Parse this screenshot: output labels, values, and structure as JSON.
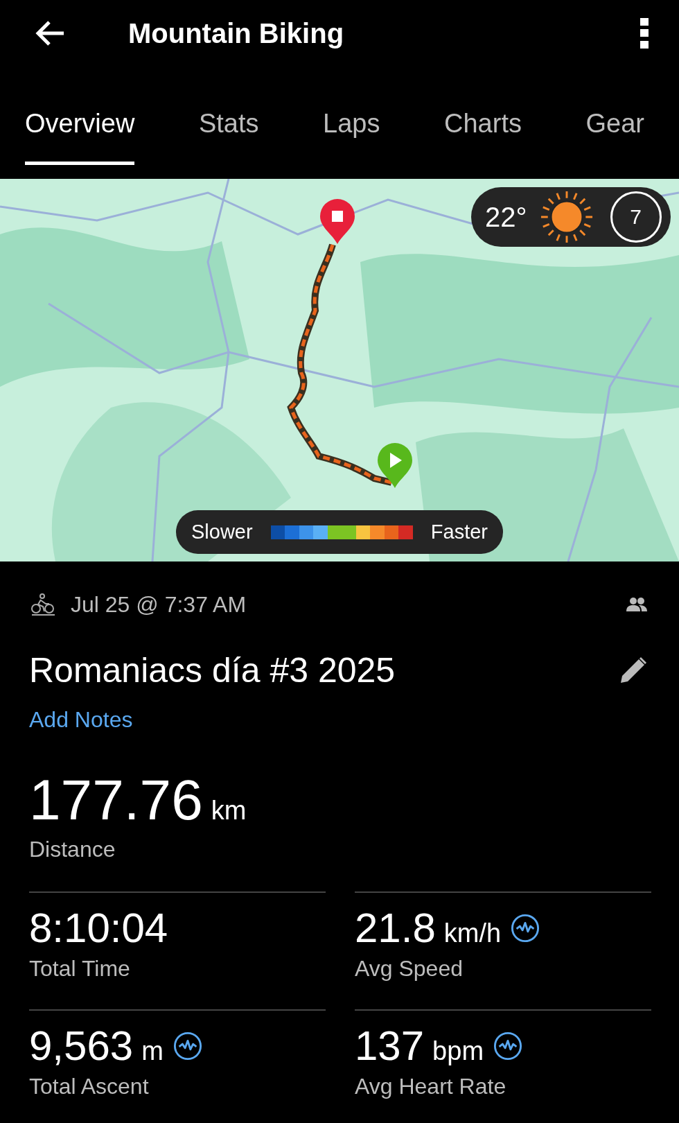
{
  "header": {
    "title": "Mountain Biking"
  },
  "tabs": [
    {
      "label": "Overview",
      "selected": true
    },
    {
      "label": "Stats",
      "selected": false
    },
    {
      "label": "Laps",
      "selected": false
    },
    {
      "label": "Charts",
      "selected": false
    },
    {
      "label": "Gear",
      "selected": false
    }
  ],
  "map": {
    "weather": {
      "temperature": "22°",
      "badge": "7"
    },
    "legend": {
      "left": "Slower",
      "right": "Faster",
      "segments": [
        {
          "color": "#0d4ea6"
        },
        {
          "color": "#1c6fd6"
        },
        {
          "color": "#3d93ea"
        },
        {
          "color": "#5ab0f5"
        },
        {
          "color": "#7cc423"
        },
        {
          "color": "#7cc423"
        },
        {
          "color": "#f8c440"
        },
        {
          "color": "#f5892a"
        },
        {
          "color": "#e8641c"
        },
        {
          "color": "#d42a24"
        }
      ]
    }
  },
  "activity": {
    "date": "Jul 25 @ 7:37 AM",
    "title": "Romaniacs día #3 2025",
    "notes_link": "Add Notes"
  },
  "headline": {
    "value": "177.76",
    "unit": "km",
    "label": "Distance"
  },
  "stats": [
    {
      "value": "8:10:04",
      "label": "Total Time",
      "kind": "plain"
    },
    {
      "value": "21.8",
      "unit": "km/h",
      "label": "Avg Speed",
      "kind": "chart"
    },
    {
      "value": "9,563",
      "unit": "m",
      "label": "Total Ascent",
      "kind": "chart"
    },
    {
      "value": "137",
      "unit": "bpm",
      "label": "Avg Heart Rate",
      "kind": "chart"
    }
  ]
}
